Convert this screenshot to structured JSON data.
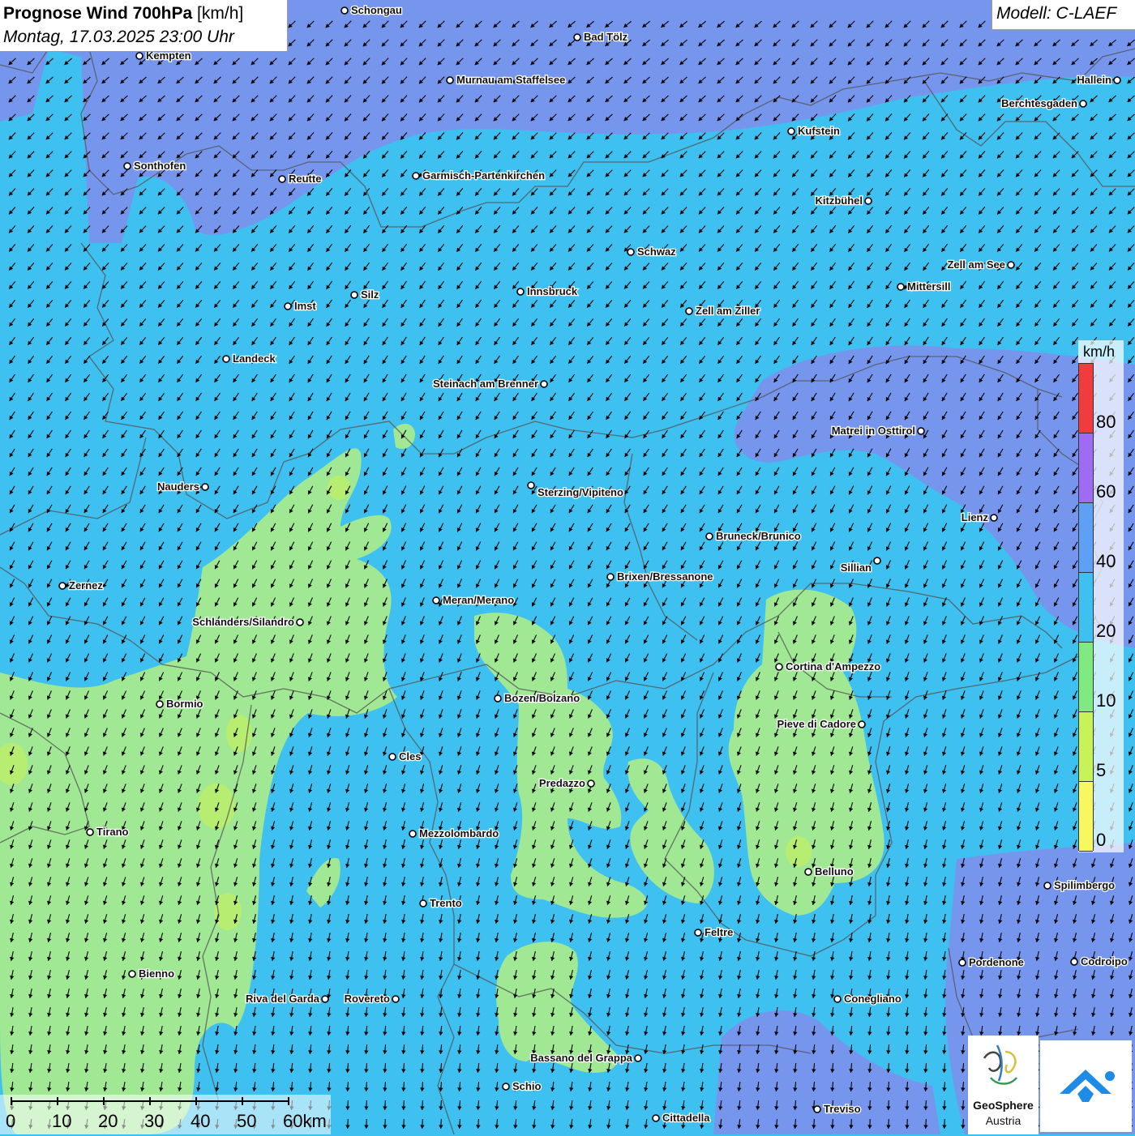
{
  "title": {
    "label_bold": "Prognose Wind 700hPa",
    "unit": " [km/h]",
    "datetime": "Montag, 17.03.2025 23:00 Uhr"
  },
  "model": "Modell: C-LAEF",
  "legend": {
    "unit": "km/h",
    "ticks": [
      "80",
      "60",
      "40",
      "20",
      "10",
      "5",
      "0"
    ],
    "colors": [
      "#f03c3c",
      "#9d6cf2",
      "#5ea0f5",
      "#3ec0f0",
      "#7fea7f",
      "#c7f25a",
      "#f7f760"
    ]
  },
  "scale": {
    "labels": [
      "0",
      "10",
      "20",
      "30",
      "40",
      "50",
      "60km"
    ]
  },
  "logos": {
    "geosphere_name": "GeoSphere",
    "geosphere_sub": "Austria"
  },
  "colors": {
    "calm_fill": "#a9ec8c",
    "moderate_fill": "#3ec0f0",
    "strong_fill": "#7b93ee",
    "border": "#555555",
    "arrow": "#000000",
    "brand_blue": "#1e8be6"
  },
  "cities": [
    {
      "name": "Schongau"
    },
    {
      "name": "Bad Tölz"
    },
    {
      "name": "Kempten"
    },
    {
      "name": "Murnau am Staffelsee"
    },
    {
      "name": "Hallein"
    },
    {
      "name": "Berchtesgaden"
    },
    {
      "name": "Kufstein"
    },
    {
      "name": "Sonthofen"
    },
    {
      "name": "Reutte"
    },
    {
      "name": "Garmisch-Partenkirchen"
    },
    {
      "name": "Kitzbühel"
    },
    {
      "name": "Schwaz"
    },
    {
      "name": "Zell am See"
    },
    {
      "name": "Mittersill"
    },
    {
      "name": "Silz"
    },
    {
      "name": "Innsbruck"
    },
    {
      "name": "Imst"
    },
    {
      "name": "Zell am Ziller"
    },
    {
      "name": "Landeck"
    },
    {
      "name": "Steinach am Brenner"
    },
    {
      "name": "Matrei in Osttirol"
    },
    {
      "name": "Nauders"
    },
    {
      "name": "Sterzing/Vipiteno"
    },
    {
      "name": "Lienz"
    },
    {
      "name": "Bruneck/Brunico"
    },
    {
      "name": "Sillian"
    },
    {
      "name": "Zernez"
    },
    {
      "name": "Brixen/Bressanone"
    },
    {
      "name": "Meran/Merano"
    },
    {
      "name": "Schlanders/Silandro"
    },
    {
      "name": "Cortina d'Ampezzo"
    },
    {
      "name": "Bozen/Bolzano"
    },
    {
      "name": "Bormio"
    },
    {
      "name": "Pieve di Cadore"
    },
    {
      "name": "Cles"
    },
    {
      "name": "Predazzo"
    },
    {
      "name": "Tirano"
    },
    {
      "name": "Mezzolombardo"
    },
    {
      "name": "Belluno"
    },
    {
      "name": "Spilimbergo"
    },
    {
      "name": "Trento"
    },
    {
      "name": "Feltre"
    },
    {
      "name": "Pordenone"
    },
    {
      "name": "Codroipo"
    },
    {
      "name": "Bienno"
    },
    {
      "name": "Riva del Garda"
    },
    {
      "name": "Rovereto"
    },
    {
      "name": "Conegliano"
    },
    {
      "name": "Bassano del Grappa"
    },
    {
      "name": "Schio"
    },
    {
      "name": "Treviso"
    },
    {
      "name": "Cittadella"
    }
  ]
}
